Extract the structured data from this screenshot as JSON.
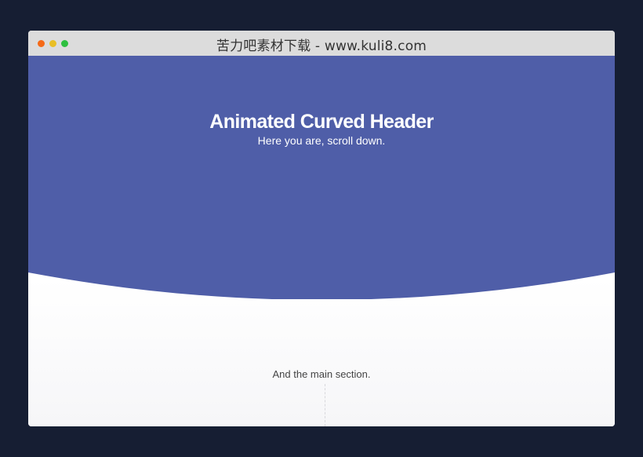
{
  "window": {
    "title": "苦力吧素材下载 - www.kuli8.com"
  },
  "header": {
    "title": "Animated Curved Header",
    "subtitle": "Here you are, scroll down.",
    "color": "#4f5ea8"
  },
  "main": {
    "text": "And the main section."
  },
  "colors": {
    "page_background": "#161e33",
    "titlebar": "#dcdcdc",
    "close": "#f56a18",
    "minimize": "#e9bf25",
    "maximize": "#2ec040"
  }
}
